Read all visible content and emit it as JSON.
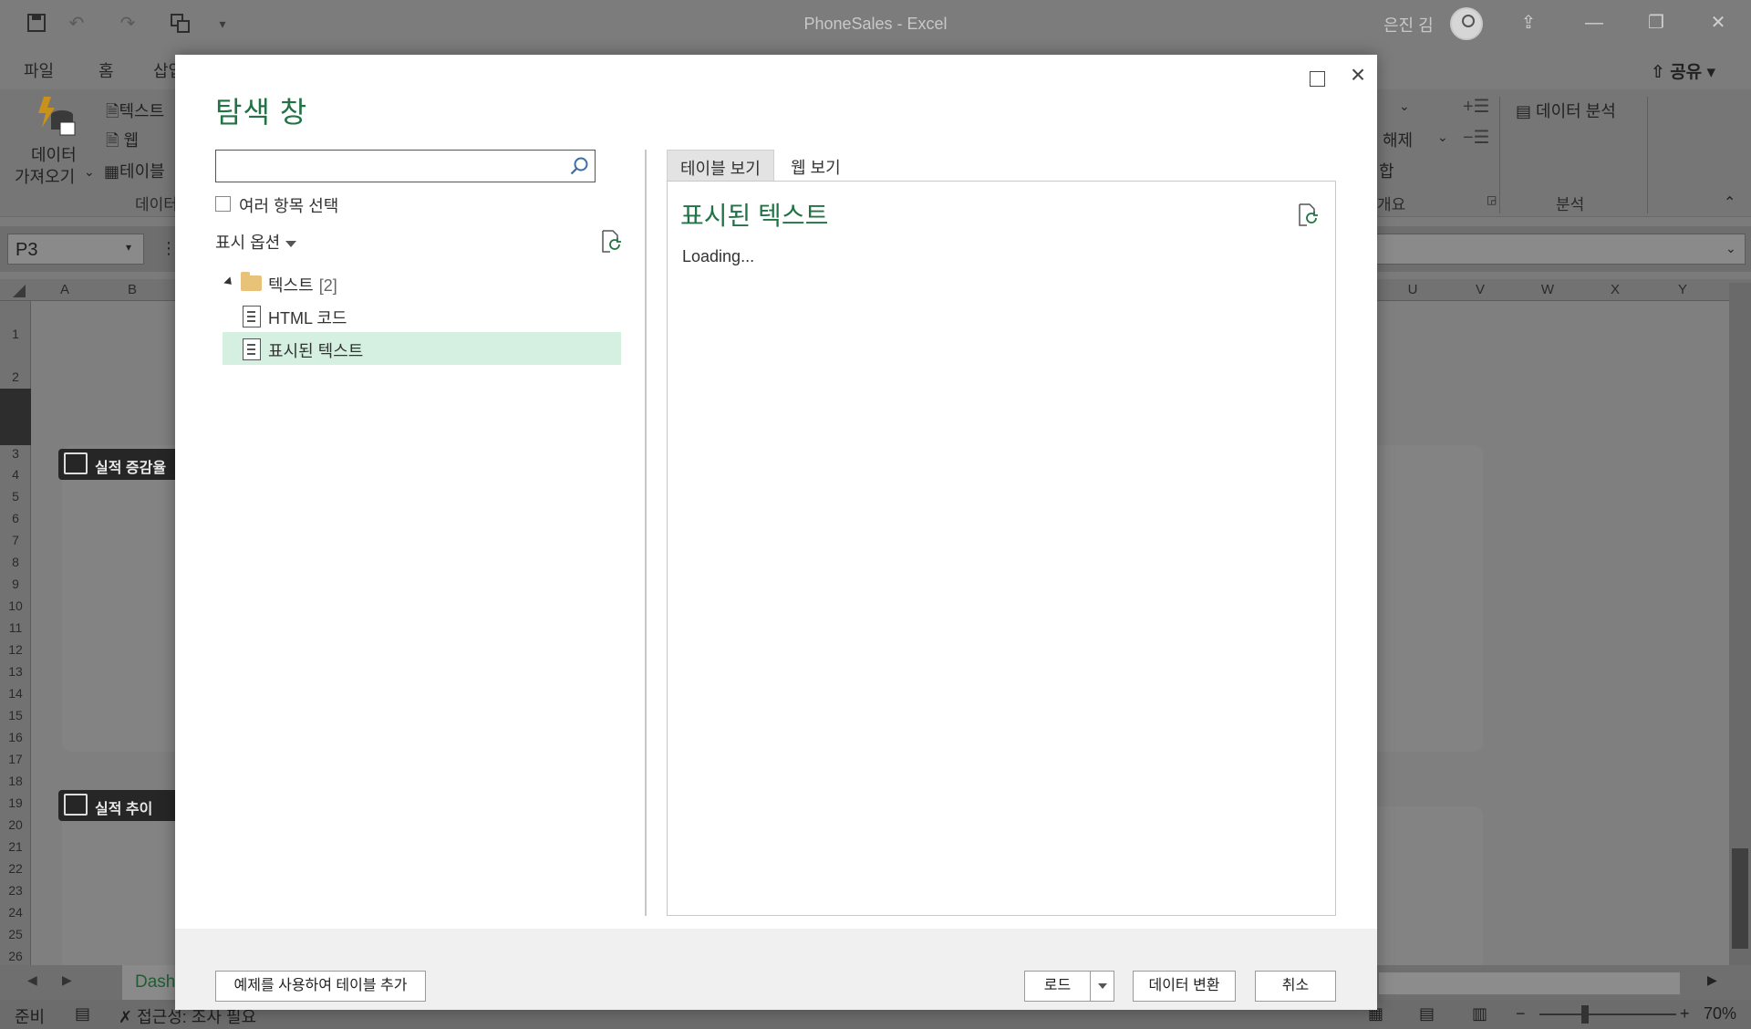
{
  "excel": {
    "window_title": "PhoneSales  -  Excel",
    "user_name": "은진 김",
    "share_label": "공유",
    "ribbon_tabs": [
      "파일",
      "홈",
      "삽입"
    ],
    "ribbon": {
      "get_data_line1": "데이터",
      "get_data_line2": "가져오기",
      "text_csv": "텍스트",
      "web": "웹",
      "table": "테이블",
      "group_data": "데이터",
      "ungroup": "해제",
      "subtotal": "합",
      "outline_group": "개요",
      "data_analysis": "데이터 분석",
      "analysis_group": "분석"
    },
    "name_box": "P3",
    "columns_left": [
      "A",
      "B"
    ],
    "columns_right": [
      "U",
      "V",
      "W",
      "X",
      "Y"
    ],
    "rows": [
      "1",
      "2",
      "3",
      "4",
      "5",
      "6",
      "7",
      "8",
      "9",
      "10",
      "11",
      "12",
      "13",
      "14",
      "15",
      "16",
      "17",
      "18",
      "19",
      "20",
      "21",
      "22",
      "23",
      "24",
      "25",
      "26"
    ],
    "card1_title": "실적 증감율",
    "card2_title": "실적 추이",
    "sheet_tab": "Dash",
    "status_ready": "준비",
    "status_accessibility": "접근성: 조사 필요",
    "zoom": "70%"
  },
  "navigator": {
    "title": "탐색 창",
    "search_placeholder": "",
    "multi_select_label": "여러 항목 선택",
    "display_options_label": "표시 옵션",
    "tree": {
      "folder_label": "텍스트",
      "folder_count": "[2]",
      "items": [
        "HTML 코드",
        "표시된 텍스트"
      ],
      "selected_index": 1
    },
    "tabs": [
      "테이블 보기",
      "웹 보기"
    ],
    "active_tab": 0,
    "preview_title": "표시된 텍스트",
    "preview_status": "Loading...",
    "buttons": {
      "add_table_using_examples": "예제를 사용하여 테이블 추가",
      "load": "로드",
      "transform": "데이터 변환",
      "cancel": "취소"
    },
    "colors": {
      "accent": "#217346",
      "selected_row": "#d5f0e1"
    }
  }
}
